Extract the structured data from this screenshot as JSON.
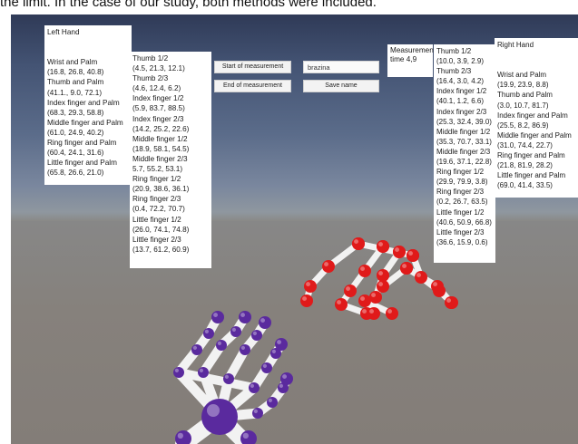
{
  "caption": "the limit. In the case of our study, both methods were included.",
  "buttons": {
    "start": "Start of measurement",
    "end": "End of measurement",
    "save": "Save name"
  },
  "name_input": {
    "value": "brazina"
  },
  "measurement_time": {
    "label": "Measurement",
    "value": "time 4,9"
  },
  "left_hand": {
    "title": "Left Hand",
    "palm_lines": [
      "Wrist and Palm",
      "(16.8, 26.8, 40.8)",
      "Thumb and Palm",
      "(41.1., 9.0, 72.1)",
      "Index finger and Palm",
      "(68.3, 29.3, 58.8)",
      "Middle finger and Palm",
      "(61.0, 24.9, 40.2)",
      "Ring finger and Palm",
      "(60.4, 24.1, 31.6)",
      "Little finger and Palm",
      "(65.8, 26.6, 21.0)"
    ],
    "finger_lines": [
      "Thumb 1/2",
      "(4.5, 21.3, 12.1)",
      "Thumb 2/3",
      "(4.6, 12.4, 6.2)",
      "Index finger 1/2",
      "(5.9, 83.7, 88.5)",
      "Index finger 2/3",
      "(14.2, 25.2, 22.6)",
      "Middle finger 1/2",
      "(18.9, 58.1, 54.5)",
      "Middle finger 2/3",
      "5.7, 55.2, 53.1)",
      "Ring finger 1/2",
      "(20.9, 38.6, 36.1)",
      "Ring finger 2/3",
      "(0.4, 72.2, 70.7)",
      "Little finger 1/2",
      "(26.0, 74.1, 74.8)",
      "Little finger 2/3",
      "(13.7, 61.2, 60.9)"
    ]
  },
  "right_hand": {
    "title": "Right Hand",
    "palm_lines": [
      "Wrist and Palm",
      "(19.9, 23.9, 8.8)",
      "Thumb and Palm",
      "(3.0, 10.7, 81.7)",
      "Index finger and Palm",
      "(25.5, 8.2, 86.9)",
      "Middle finger and Palm",
      "(31.0, 74.4, 22.7)",
      "Ring finger and Palm",
      "(21.8, 81.9, 28.2)",
      "Little finger and Palm",
      "(69.0, 41.4, 33.5)"
    ],
    "finger_lines": [
      "Thumb 1/2",
      "(10.0, 3.9, 2.9)",
      "Thumb 2/3",
      "(16.4, 3.0, 4.2)",
      "Index finger 1/2",
      "(40.1, 1.2, 6.6)",
      "Index finger 2/3",
      "(25.3, 32.4, 39.0)",
      "Middle finger 1/2",
      "(35.3, 70.7, 33.1)",
      "Middle finger 2/3",
      "(19.6, 37.1, 22.8)",
      "Ring finger 1/2",
      "(29.9, 79.9, 3.8)",
      "Ring finger 2/3",
      "(0.2, 26.7, 63.5)",
      "Little finger 1/2",
      "(40.6, 50.9, 66.8)",
      "Little finger 2/3",
      "(36.6, 15.9, 0.6)"
    ]
  },
  "colors": {
    "left_hand_joints": "#5a2a9e",
    "right_hand_joints": "#e01a1a",
    "bones": "#f2f2f2"
  }
}
